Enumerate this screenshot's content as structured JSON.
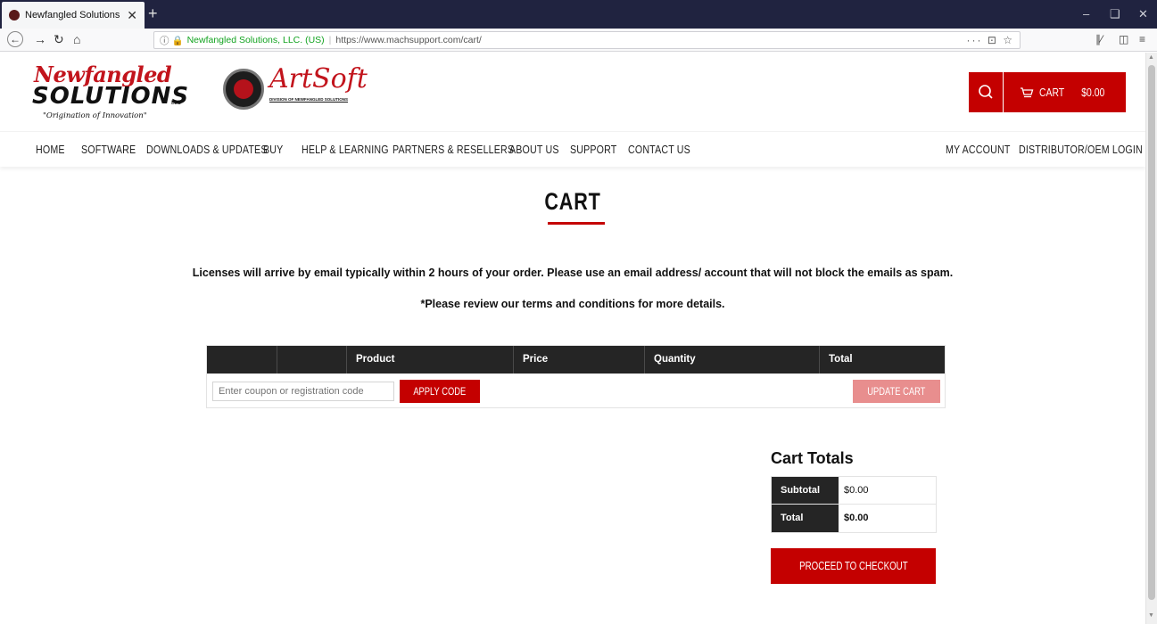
{
  "browser": {
    "tab_title": "Newfangled Solutions Cart",
    "tab_close": "✕",
    "new_tab": "+",
    "url_site": "Newfangled Solutions, LLC. (US)",
    "url": "https://www.machsupport.com/cart/",
    "url_tools": "··· ⊡ ☆"
  },
  "logos": {
    "nf_top": "Newfangled",
    "nf_mid": "SOLUTIONS",
    "nf_llc": "LLC",
    "nf_tagline": "\"Origination of Innovation\"",
    "as_word": "ArtSoft",
    "as_sub": "DIVISION OF NEWFANGLED SOLUTIONS"
  },
  "header": {
    "cart_label": "CART",
    "cart_amount": "$0.00"
  },
  "nav": {
    "left": [
      "HOME",
      "SOFTWARE",
      "DOWNLOADS & UPDATES",
      "BUY",
      "HELP & LEARNING",
      "PARTNERS & RESELLERS",
      "ABOUT US",
      "SUPPORT",
      "CONTACT US"
    ],
    "right": [
      "MY ACCOUNT",
      "DISTRIBUTOR/OEM LOGIN"
    ]
  },
  "page": {
    "title": "CART",
    "notice": "Licenses will arrive by email typically within 2 hours of your order.  Please use an email address/ account that will not block the emails as spam.",
    "notice2": "*Please review our terms and conditions for more details."
  },
  "cart_table": {
    "headers": [
      "",
      "",
      "Product",
      "Price",
      "Quantity",
      "Total"
    ],
    "coupon_placeholder": "Enter coupon or registration code",
    "apply_label": "APPLY CODE",
    "update_label": "UPDATE CART"
  },
  "totals": {
    "title": "Cart Totals",
    "rows": [
      {
        "label": "Subtotal",
        "value": "$0.00"
      },
      {
        "label": "Total",
        "value": "$0.00"
      }
    ],
    "checkout_label": "PROCEED TO CHECKOUT"
  },
  "colors": {
    "accent": "#c40000",
    "dark": "#252525",
    "tabbar": "#202340"
  }
}
